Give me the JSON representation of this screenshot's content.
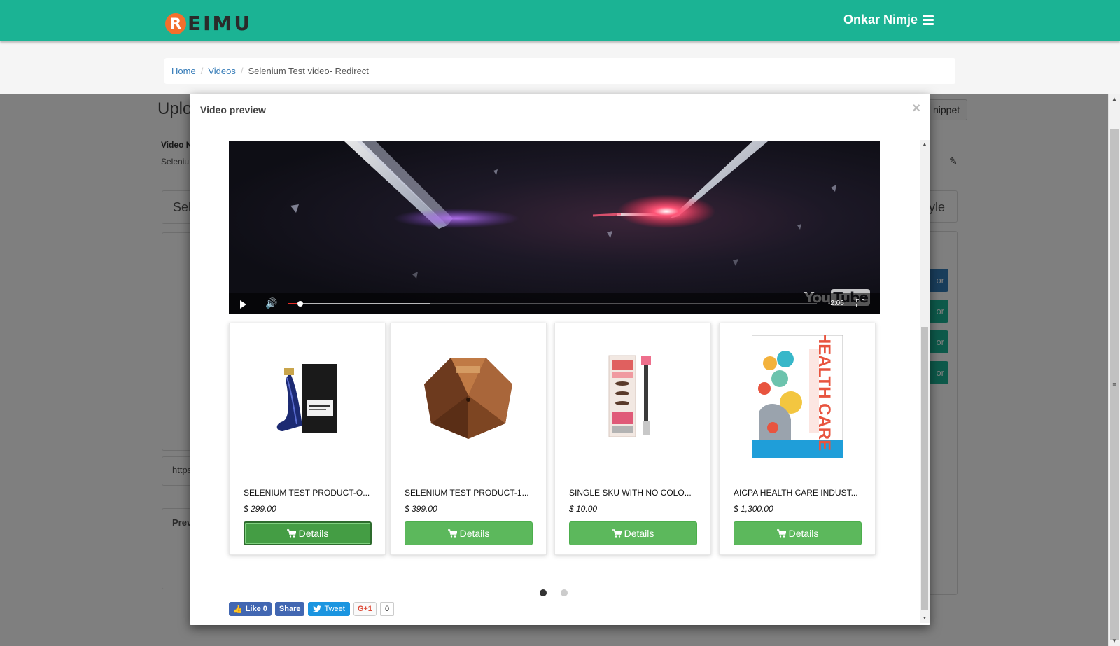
{
  "header": {
    "logo_letter": "R",
    "logo_text": "EIMU",
    "user_name": "Onkar Nimje"
  },
  "breadcrumb": {
    "home": "Home",
    "videos": "Videos",
    "current": "Selenium Test video- Redirect"
  },
  "background": {
    "title": "Uplo",
    "video_label": "Video N",
    "video_value": "Seleniu",
    "panel_text": "Sel",
    "url_text": "https",
    "preview_label": "Prev",
    "snippet_button": "nippet",
    "style_text": "yle",
    "color_button": "or"
  },
  "modal": {
    "title": "Video preview",
    "close": "×"
  },
  "video": {
    "logo_you": "You",
    "logo_tube": "Tube",
    "time_remaining": "-2:06",
    "played_fraction": 0.024,
    "buffered_fraction": 0.27
  },
  "products": [
    {
      "name": "SELENIUM TEST PRODUCT-O...",
      "price": "$ 299.00",
      "button": "Details"
    },
    {
      "name": "SELENIUM TEST PRODUCT-1...",
      "price": "$ 399.00",
      "button": "Details"
    },
    {
      "name": "SINGLE SKU WITH NO COLO...",
      "price": "$ 10.00",
      "button": "Details"
    },
    {
      "name": "AICPA HEALTH CARE INDUST...",
      "price": "$ 1,300.00",
      "button": "Details"
    }
  ],
  "carousel": {
    "pages": 2,
    "current": 1
  },
  "social": {
    "like": "Like 0",
    "share": "Share",
    "tweet": "Tweet",
    "gplus": "G+1",
    "gplus_count": "0"
  },
  "colors": {
    "header_bg": "#1bb394",
    "details_button": "#5cb85c",
    "link": "#337ab7",
    "logo_badge": "#f36f2c"
  }
}
